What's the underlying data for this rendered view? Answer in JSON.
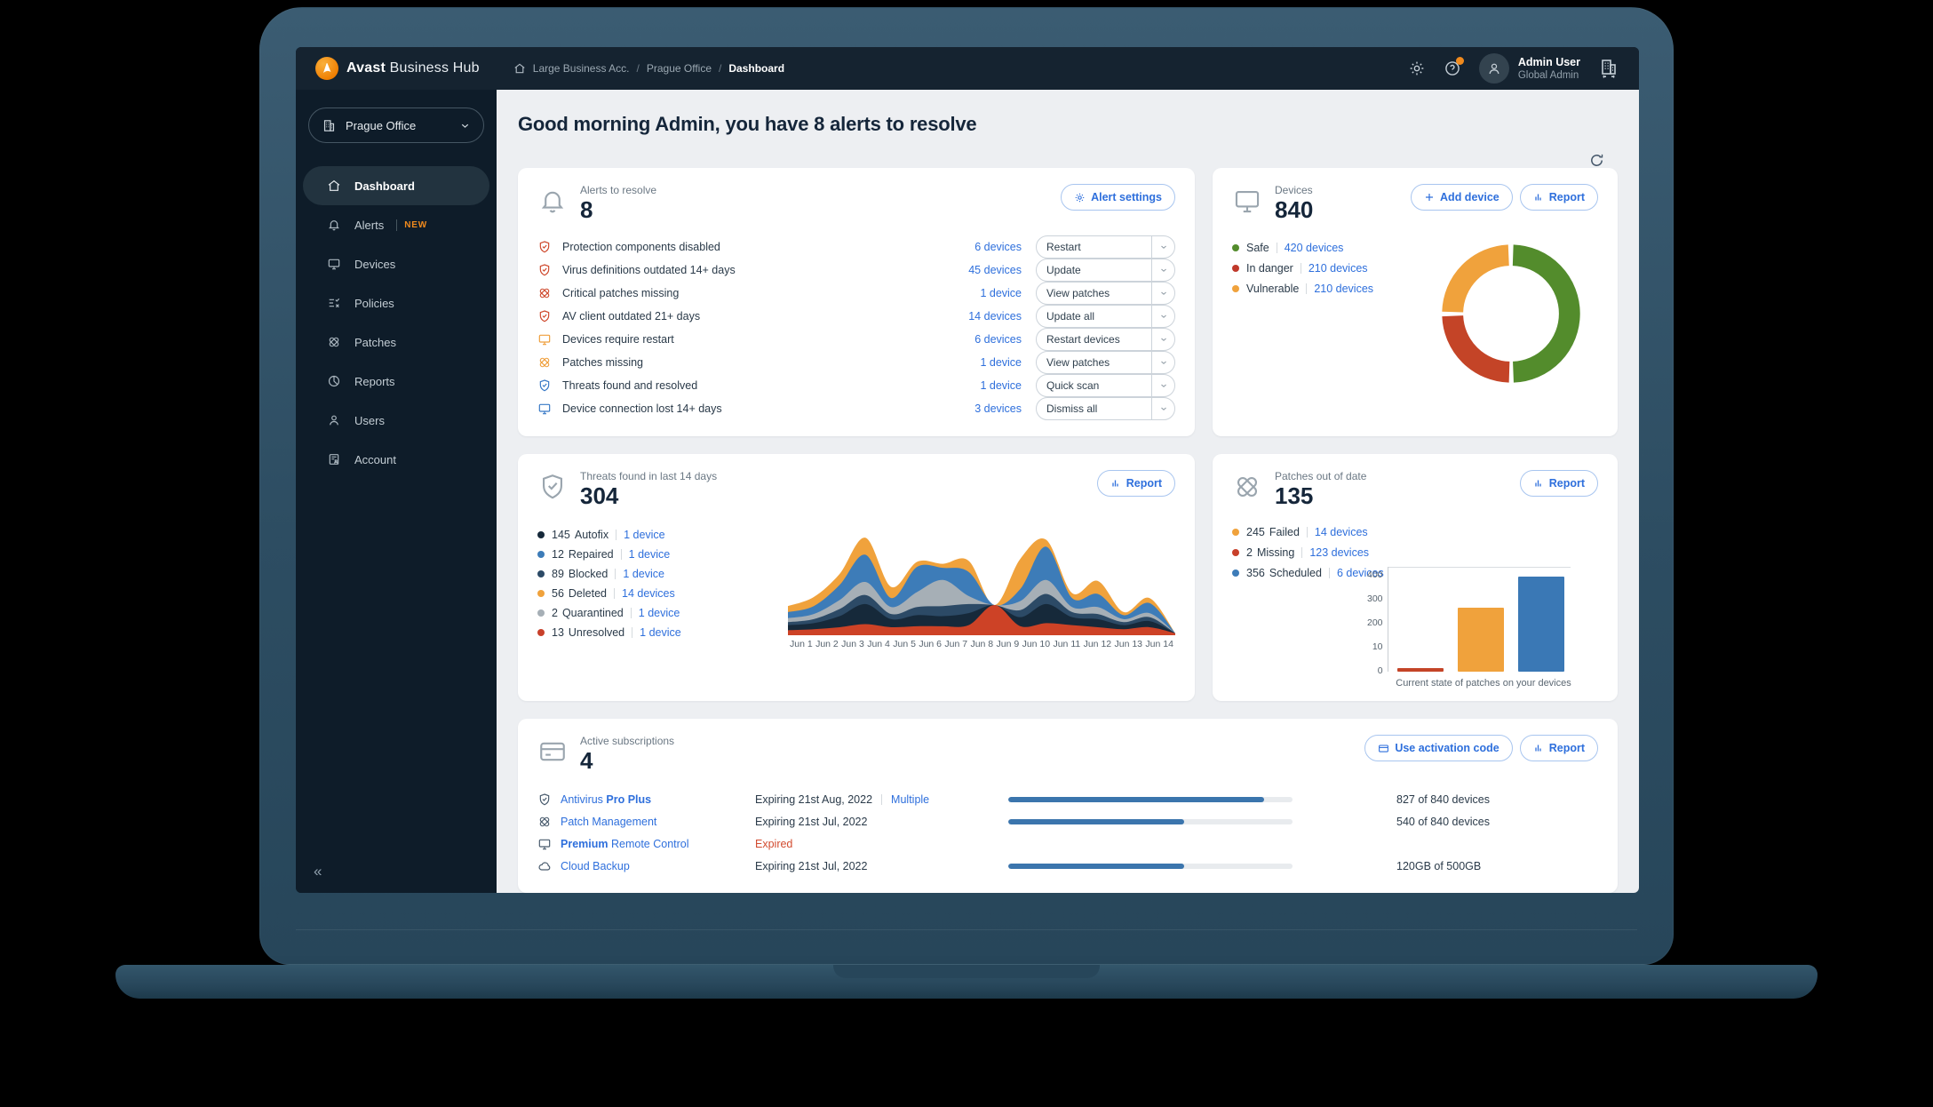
{
  "brand": {
    "bold": "Avast",
    "light": "Business Hub"
  },
  "topbar": {
    "breadcrumb": [
      {
        "label": "Large Business Acc."
      },
      {
        "label": "Prague Office"
      },
      {
        "label": "Dashboard",
        "current": true
      }
    ],
    "user_name": "Admin User",
    "user_role": "Global Admin"
  },
  "sidebar": {
    "org_selector": "Prague Office",
    "items": [
      {
        "label": "Dashboard",
        "icon": "home-icon",
        "active": true
      },
      {
        "label": "Alerts",
        "icon": "bell-icon",
        "badge": "NEW"
      },
      {
        "label": "Devices",
        "icon": "monitor-icon"
      },
      {
        "label": "Policies",
        "icon": "policies-icon"
      },
      {
        "label": "Patches",
        "icon": "patch-icon"
      },
      {
        "label": "Reports",
        "icon": "reports-icon"
      },
      {
        "label": "Users",
        "icon": "users-icon"
      },
      {
        "label": "Account",
        "icon": "account-icon"
      }
    ]
  },
  "main": {
    "greeting": "Good morning Admin, you have 8 alerts to resolve",
    "alerts_card": {
      "title": "Alerts to resolve",
      "count": "8",
      "settings_button": "Alert settings",
      "rows": [
        {
          "label": "Protection components disabled",
          "devices": "6 devices",
          "action": "Restart",
          "icon": "shield-check-icon",
          "severity": "red"
        },
        {
          "label": "Virus definitions outdated 14+ days",
          "devices": "45 devices",
          "action": "Update",
          "icon": "shield-check-icon",
          "severity": "red"
        },
        {
          "label": "Critical patches missing",
          "devices": "1 device",
          "action": "View patches",
          "icon": "patch-icon",
          "severity": "red"
        },
        {
          "label": "AV client outdated 21+ days",
          "devices": "14 devices",
          "action": "Update all",
          "icon": "shield-check-icon",
          "severity": "red"
        },
        {
          "label": "Devices require restart",
          "devices": "6 devices",
          "action": "Restart devices",
          "icon": "monitor-icon",
          "severity": "orange"
        },
        {
          "label": "Patches missing",
          "devices": "1 device",
          "action": "View patches",
          "icon": "patch-icon",
          "severity": "orange"
        },
        {
          "label": "Threats found and resolved",
          "devices": "1 device",
          "action": "Quick scan",
          "icon": "shield-check-icon",
          "severity": "blue"
        },
        {
          "label": "Device connection lost 14+ days",
          "devices": "3 devices",
          "action": "Dismiss all",
          "icon": "monitor-icon",
          "severity": "blue"
        }
      ]
    },
    "devices_card": {
      "title": "Devices",
      "count": "840",
      "add_button": "Add device",
      "report_button": "Report",
      "legend": [
        {
          "label": "Safe",
          "devices": "420 devices",
          "color": "#538c2c"
        },
        {
          "label": "In danger",
          "devices": "210 devices",
          "color": "#c0392b"
        },
        {
          "label": "Vulnerable",
          "devices": "210 devices",
          "color": "#f0a23c"
        }
      ],
      "chart_data": {
        "type": "pie",
        "labels": [
          "Safe",
          "In danger",
          "Vulnerable"
        ],
        "values": [
          420,
          210,
          210
        ],
        "colors": [
          "#538c2c",
          "#c44427",
          "#f0a23c"
        ],
        "donut": true
      }
    },
    "threats_card": {
      "title": "Threats found in last 14 days",
      "count": "304",
      "report_button": "Report",
      "legend": [
        {
          "value": "145",
          "label": "Autofix",
          "devices": "1 device",
          "color": "#16293a"
        },
        {
          "value": "12",
          "label": "Repaired",
          "devices": "1 device",
          "color": "#3d7cb8"
        },
        {
          "value": "89",
          "label": "Blocked",
          "devices": "1 device",
          "color": "#2c4a66"
        },
        {
          "value": "56",
          "label": "Deleted",
          "devices": "14 devices",
          "color": "#f0a23c"
        },
        {
          "value": "2",
          "label": "Quarantined",
          "devices": "1 device",
          "color": "#a6afb6"
        },
        {
          "value": "13",
          "label": "Unresolved",
          "devices": "1 device",
          "color": "#c8402a"
        }
      ],
      "chart_data": {
        "type": "area",
        "stacked": true,
        "x_labels": [
          "Jun 1",
          "Jun 2",
          "Jun 3",
          "Jun 4",
          "Jun 5",
          "Jun 6",
          "Jun 7",
          "Jun 8",
          "Jun 9",
          "Jun 10",
          "Jun 11",
          "Jun 12",
          "Jun 13",
          "Jun 14"
        ],
        "series": [
          {
            "name": "Unresolved",
            "color": "#cd4226",
            "values": [
              5,
              6,
              8,
              11,
              8,
              9,
              9,
              10,
              30,
              9,
              12,
              10,
              8,
              6,
              8,
              2
            ]
          },
          {
            "name": "Autofix",
            "color": "#16293a",
            "values": [
              5,
              6,
              11,
              20,
              8,
              11,
              10,
              12,
              0,
              9,
              19,
              8,
              8,
              4,
              6,
              0
            ]
          },
          {
            "name": "Blocked",
            "color": "#2c4a66",
            "values": [
              3,
              4,
              7,
              9,
              5,
              8,
              10,
              9,
              0,
              7,
              10,
              5,
              5,
              3,
              4,
              0
            ]
          },
          {
            "name": "Quarantined",
            "color": "#a6afb6",
            "values": [
              4,
              5,
              9,
              13,
              7,
              15,
              26,
              8,
              0,
              9,
              14,
              5,
              7,
              3,
              4,
              0
            ]
          },
          {
            "name": "Repaired",
            "color": "#3d7cb8",
            "values": [
              6,
              8,
              15,
              27,
              9,
              25,
              12,
              24,
              0,
              12,
              33,
              9,
              13,
              4,
              10,
              0
            ]
          },
          {
            "name": "Deleted",
            "color": "#f0a23c",
            "values": [
              6,
              9,
              11,
              17,
              11,
              5,
              4,
              11,
              0,
              30,
              7,
              5,
              13,
              3,
              5,
              0
            ]
          }
        ]
      }
    },
    "patches_card": {
      "title": "Patches out of date",
      "count": "135",
      "report_button": "Report",
      "legend": [
        {
          "value": "245",
          "label": "Failed",
          "devices": "14 devices",
          "color": "#f0a23c"
        },
        {
          "value": "2",
          "label": "Missing",
          "devices": "123 devices",
          "color": "#c8402a"
        },
        {
          "value": "356",
          "label": "Scheduled",
          "devices": "6 devices",
          "color": "#3d7cb8"
        }
      ],
      "chart_data": {
        "type": "bar",
        "categories": [
          "Missing",
          "Failed",
          "Scheduled"
        ],
        "values": [
          12,
          245,
          362
        ],
        "colors": [
          "#c44427",
          "#f0a23c",
          "#3a78b5"
        ],
        "ymax": 400,
        "y_ticks": [
          "400",
          "300",
          "200",
          "10",
          "0"
        ],
        "caption": "Current state of patches on your devices"
      }
    },
    "subscriptions_card": {
      "title": "Active subscriptions",
      "count": "4",
      "activation_button": "Use activation code",
      "report_button": "Report",
      "rows": [
        {
          "name_pre": "Antivirus ",
          "name_bold": "Pro Plus",
          "name_post": "",
          "icon": "shield-check-icon",
          "expiry": "Expiring 21st Aug, 2022",
          "extra": "Multiple",
          "progress": 90,
          "usage": "827 of 840 devices"
        },
        {
          "name_pre": "Patch Management",
          "name_bold": "",
          "name_post": "",
          "icon": "patch-icon",
          "expiry": "Expiring 21st Jul, 2022",
          "progress": 62,
          "usage": "540 of 840 devices"
        },
        {
          "name_pre": "",
          "name_bold": "Premium",
          "name_post": " Remote Control",
          "icon": "monitor-icon",
          "expiry": "Expired",
          "expired": true
        },
        {
          "name_pre": "Cloud Backup",
          "name_bold": "",
          "name_post": "",
          "icon": "cloud-icon",
          "expiry": "Expiring 21st Jul, 2022",
          "progress": 62,
          "usage": "120GB of 500GB"
        }
      ]
    }
  }
}
